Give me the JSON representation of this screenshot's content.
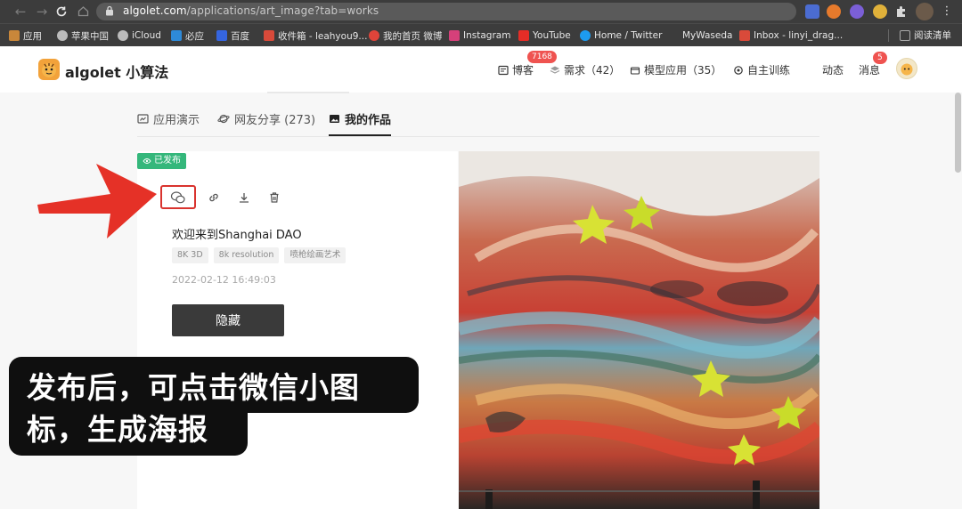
{
  "browser": {
    "url_host": "algolet.com",
    "url_path": "/applications/art_image?tab=works",
    "bookmarks": [
      "应用",
      "苹果中国",
      "iCloud",
      "必应",
      "百度",
      "收件箱 - leahyou9...",
      "我的首页 微博",
      "Instagram",
      "YouTube",
      "Home / Twitter",
      "MyWaseda",
      "Inbox - linyi_drag..."
    ],
    "reading_list": "阅读清单"
  },
  "site": {
    "logo_text": "algolet 小算法",
    "nav": {
      "blog": "博客",
      "blog_badge": "7168",
      "demand": "需求（42）",
      "models": "模型应用（35）",
      "training": "自主训练",
      "activity": "动态",
      "messages": "消息",
      "messages_badge": "5"
    }
  },
  "tabs": {
    "demo": "应用演示",
    "shares": "网友分享 (273)",
    "works": "我的作品"
  },
  "work": {
    "status": "已发布",
    "title": "欢迎来到Shanghai DAO",
    "tags": [
      "8K 3D",
      "8k resolution",
      "喷枪绘画艺术"
    ],
    "timestamp": "2022-02-12 16:49:03",
    "hide_button": "隐藏"
  },
  "annotation": {
    "tip": "发布后，可点击微信小图标，生成海报",
    "arrow_color": "#e53127"
  },
  "colors": {
    "status_green": "#34b77b",
    "badge_red": "#ef5350",
    "highlight_red": "#d9332e"
  }
}
